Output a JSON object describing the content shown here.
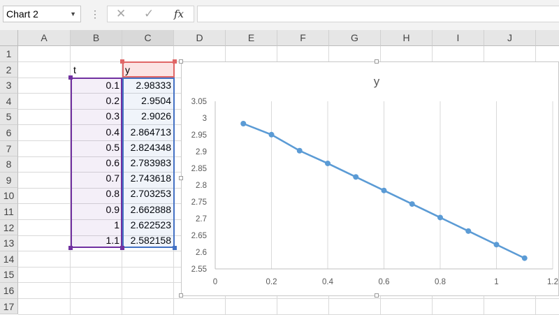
{
  "formula_bar": {
    "name_box": "Chart 2",
    "more_icon": "⋮",
    "cancel_icon": "✕",
    "enter_icon": "✓",
    "function_icon": "fx",
    "formula": ""
  },
  "columns": [
    "A",
    "B",
    "C",
    "D",
    "E",
    "F",
    "G",
    "H",
    "I",
    "J"
  ],
  "rows": [
    "1",
    "2",
    "3",
    "4",
    "5",
    "6",
    "7",
    "8",
    "9",
    "10",
    "11",
    "12",
    "13",
    "14",
    "15",
    "16",
    "17"
  ],
  "headers": {
    "t": "t",
    "y": "y"
  },
  "table": {
    "t": [
      "0.1",
      "0.2",
      "0.3",
      "0.4",
      "0.5",
      "0.6",
      "0.7",
      "0.8",
      "0.9",
      "1",
      "1.1"
    ],
    "y": [
      "2.98333",
      "2.9504",
      "2.9026",
      "2.864713",
      "2.824348",
      "2.783983",
      "2.743618",
      "2.703253",
      "2.662888",
      "2.622523",
      "2.582158"
    ]
  },
  "colors": {
    "series": "#5b9bd5",
    "range_t": "#7030a0",
    "range_y": "#4472c4",
    "header_range": "#e06666"
  },
  "chart_data": {
    "type": "scatter",
    "title": "y",
    "series": [
      {
        "name": "y",
        "x": [
          0.1,
          0.2,
          0.3,
          0.4,
          0.5,
          0.6,
          0.7,
          0.8,
          0.9,
          1,
          1.1
        ],
        "y": [
          2.98333,
          2.9504,
          2.9026,
          2.864713,
          2.824348,
          2.783983,
          2.743618,
          2.703253,
          2.662888,
          2.622523,
          2.582158
        ],
        "line": true,
        "markers": true
      }
    ],
    "xlim": [
      0,
      1.2
    ],
    "ylim": [
      2.55,
      3.05
    ],
    "x_ticks": [
      "0",
      "0.2",
      "0.4",
      "0.6",
      "0.8",
      "1",
      "1.2"
    ],
    "y_ticks": [
      "2.55",
      "2.6",
      "2.65",
      "2.7",
      "2.75",
      "2.8",
      "2.85",
      "2.9",
      "2.95",
      "3",
      "3.05"
    ],
    "grid": "vertical",
    "legend": "none"
  }
}
